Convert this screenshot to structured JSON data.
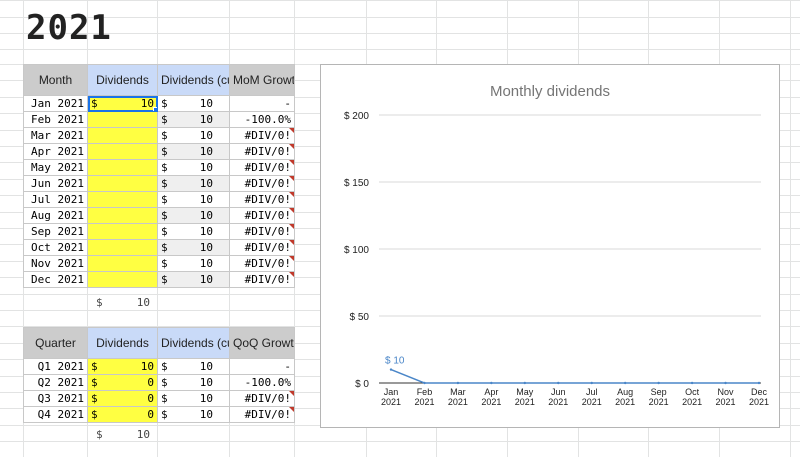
{
  "title": "2021",
  "monthly": {
    "headers": [
      "Month",
      "Dividends",
      "Dividends (cumulative)",
      "MoM Growth"
    ],
    "rows": [
      {
        "label": "Jan 2021",
        "dividend": "10",
        "cumulative": "10",
        "growth": "-"
      },
      {
        "label": "Feb 2021",
        "dividend": "",
        "cumulative": "10",
        "growth": "-100.0%"
      },
      {
        "label": "Mar 2021",
        "dividend": "",
        "cumulative": "10",
        "growth": "#DIV/0!"
      },
      {
        "label": "Apr 2021",
        "dividend": "",
        "cumulative": "10",
        "growth": "#DIV/0!"
      },
      {
        "label": "May 2021",
        "dividend": "",
        "cumulative": "10",
        "growth": "#DIV/0!"
      },
      {
        "label": "Jun 2021",
        "dividend": "",
        "cumulative": "10",
        "growth": "#DIV/0!"
      },
      {
        "label": "Jul 2021",
        "dividend": "",
        "cumulative": "10",
        "growth": "#DIV/0!"
      },
      {
        "label": "Aug 2021",
        "dividend": "",
        "cumulative": "10",
        "growth": "#DIV/0!"
      },
      {
        "label": "Sep 2021",
        "dividend": "",
        "cumulative": "10",
        "growth": "#DIV/0!"
      },
      {
        "label": "Oct 2021",
        "dividend": "",
        "cumulative": "10",
        "growth": "#DIV/0!"
      },
      {
        "label": "Nov 2021",
        "dividend": "",
        "cumulative": "10",
        "growth": "#DIV/0!"
      },
      {
        "label": "Dec 2021",
        "dividend": "",
        "cumulative": "10",
        "growth": "#DIV/0!"
      }
    ],
    "total": "10"
  },
  "quarterly": {
    "headers": [
      "Quarter",
      "Dividends",
      "Dividends (cumulative)",
      "QoQ Growth"
    ],
    "rows": [
      {
        "label": "Q1 2021",
        "dividend": "10",
        "cumulative": "10",
        "growth": "-"
      },
      {
        "label": "Q2 2021",
        "dividend": "0",
        "cumulative": "10",
        "growth": "-100.0%"
      },
      {
        "label": "Q3 2021",
        "dividend": "0",
        "cumulative": "10",
        "growth": "#DIV/0!"
      },
      {
        "label": "Q4 2021",
        "dividend": "0",
        "cumulative": "10",
        "growth": "#DIV/0!"
      }
    ],
    "total": "10"
  },
  "currency_symbol": "$",
  "colors": {
    "header_gray": "#cccccc",
    "header_blue": "#c9daf8",
    "input_yellow": "#ffff42",
    "series_blue": "#4a86c8",
    "error_flag": "#c0392b"
  },
  "chart_data": {
    "type": "line",
    "title": "Monthly dividends",
    "categories": [
      "Jan 2021",
      "Feb 2021",
      "Mar 2021",
      "Apr 2021",
      "May 2021",
      "Jun 2021",
      "Jul 2021",
      "Aug 2021",
      "Sep 2021",
      "Oct 2021",
      "Nov 2021",
      "Dec 2021"
    ],
    "series": [
      {
        "values": [
          10,
          0,
          0,
          0,
          0,
          0,
          0,
          0,
          0,
          0,
          0,
          0
        ]
      }
    ],
    "point_labels": [
      "$ 10"
    ],
    "ylim": [
      0,
      200
    ],
    "y_ticks": [
      0,
      50,
      100,
      150,
      200
    ],
    "y_tick_labels": [
      "$ 0",
      "$ 50",
      "$ 100",
      "$ 150",
      "$ 200"
    ],
    "grid": true,
    "legend": "none"
  }
}
